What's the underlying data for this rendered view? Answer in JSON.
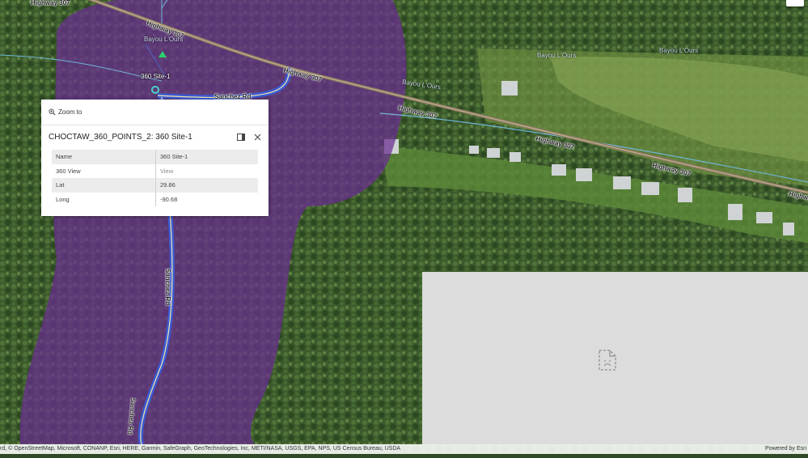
{
  "map": {
    "labels": {
      "highway_307": "Highway 307",
      "sanchez_rd": "Sanchez Rd",
      "bayou_lours": "Bayou L'Ours",
      "bayou_lours_alt": "Bayou L'Ours",
      "site_label": "360 Site-1"
    },
    "colors": {
      "buffer": "#6a2d91",
      "road": "#3b5bd6",
      "highway": "#8c7b63",
      "water": "#6fb5d6"
    }
  },
  "popup": {
    "zoom_to_label": "Zoom to",
    "title": "CHOCTAW_360_POINTS_2: 360 Site-1",
    "rows": [
      {
        "key": "Name",
        "value": "360 Site-1"
      },
      {
        "key": "360 View",
        "value": "View"
      },
      {
        "key": "Lat",
        "value": "29.86"
      },
      {
        "key": "Long",
        "value": "-90.68"
      }
    ],
    "icons": {
      "zoom": "zoom-in-icon",
      "dock": "dock-icon",
      "close": "close-icon"
    }
  },
  "broken_embed": {
    "icon": "broken-document-icon"
  },
  "attribution": {
    "sources": "rd, © OpenStreetMap, Microsoft, CONANP, Esri, HERE, Garmin, SafeGraph, GeoTechnologies, Inc, METI/NASA, USGS, EPA, NPS, US Census Bureau, USDA",
    "powered_by": "Powered by Esri"
  }
}
